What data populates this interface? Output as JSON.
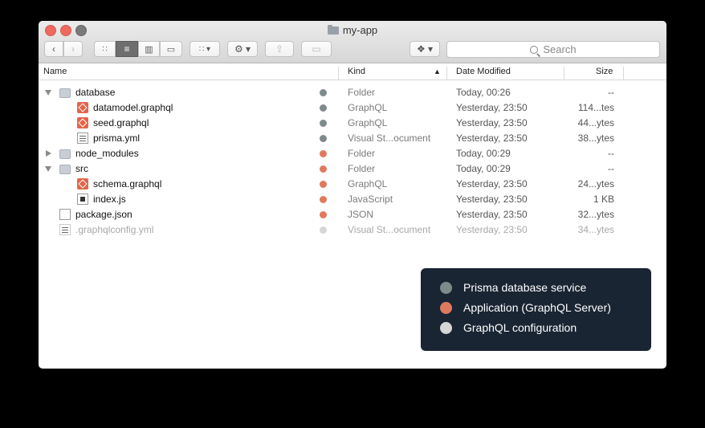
{
  "window": {
    "title": "my-app"
  },
  "toolbar": {
    "back_icon": "chevron-left-icon",
    "forward_icon": "chevron-right-icon",
    "views": [
      "icon-view-icon",
      "list-view-icon",
      "column-view-icon",
      "coverflow-view-icon"
    ],
    "arrange_icon": "grid-icon",
    "action_icon": "gear-icon",
    "share_icon": "share-icon",
    "tag_icon": "tag-icon",
    "dropbox_icon": "dropbox-icon",
    "search_placeholder": "Search"
  },
  "columns": {
    "name": "Name",
    "kind": "Kind",
    "date": "Date Modified",
    "size": "Size"
  },
  "colors": {
    "prisma": "#7f8b8b",
    "app": "#e07a5f",
    "config": "#d6d6d6"
  },
  "rows": [
    {
      "name": "database",
      "kind": "Folder",
      "date": "Today, 00:26",
      "size": "--",
      "icon": "folder-icon",
      "group": "prisma",
      "indent": 0,
      "arrow": "open"
    },
    {
      "name": "datamodel.graphql",
      "kind": "GraphQL",
      "date": "Yesterday, 23:50",
      "size": "114...tes",
      "icon": "graphql-file-icon",
      "group": "prisma",
      "indent": 1,
      "arrow": ""
    },
    {
      "name": "seed.graphql",
      "kind": "GraphQL",
      "date": "Yesterday, 23:50",
      "size": "44...ytes",
      "icon": "graphql-file-icon",
      "group": "prisma",
      "indent": 1,
      "arrow": ""
    },
    {
      "name": "prisma.yml",
      "kind": "Visual St...ocument",
      "date": "Yesterday, 23:50",
      "size": "38...ytes",
      "icon": "yml-file-icon",
      "group": "prisma",
      "indent": 1,
      "arrow": ""
    },
    {
      "name": "node_modules",
      "kind": "Folder",
      "date": "Today, 00:29",
      "size": "--",
      "icon": "folder-icon",
      "group": "app",
      "indent": 0,
      "arrow": "closed"
    },
    {
      "name": "src",
      "kind": "Folder",
      "date": "Today, 00:29",
      "size": "--",
      "icon": "folder-icon",
      "group": "app",
      "indent": 0,
      "arrow": "open"
    },
    {
      "name": "schema.graphql",
      "kind": "GraphQL",
      "date": "Yesterday, 23:50",
      "size": "24...ytes",
      "icon": "graphql-file-icon",
      "group": "app",
      "indent": 1,
      "arrow": ""
    },
    {
      "name": "index.js",
      "kind": "JavaScript",
      "date": "Yesterday, 23:50",
      "size": "1 KB",
      "icon": "js-file-icon",
      "group": "app",
      "indent": 1,
      "arrow": ""
    },
    {
      "name": "package.json",
      "kind": "JSON",
      "date": "Yesterday, 23:50",
      "size": "32...ytes",
      "icon": "json-file-icon",
      "group": "app",
      "indent": 0,
      "arrow": ""
    },
    {
      "name": ".graphqlconfig.yml",
      "kind": "Visual St...ocument",
      "date": "Yesterday, 23:50",
      "size": "34...ytes",
      "icon": "yml-file-icon",
      "group": "config",
      "indent": 0,
      "arrow": "",
      "faded": true
    }
  ],
  "legend": [
    {
      "label": "Prisma database service",
      "group": "prisma"
    },
    {
      "label": "Application (GraphQL Server)",
      "group": "app"
    },
    {
      "label": "GraphQL configuration",
      "group": "config"
    }
  ]
}
